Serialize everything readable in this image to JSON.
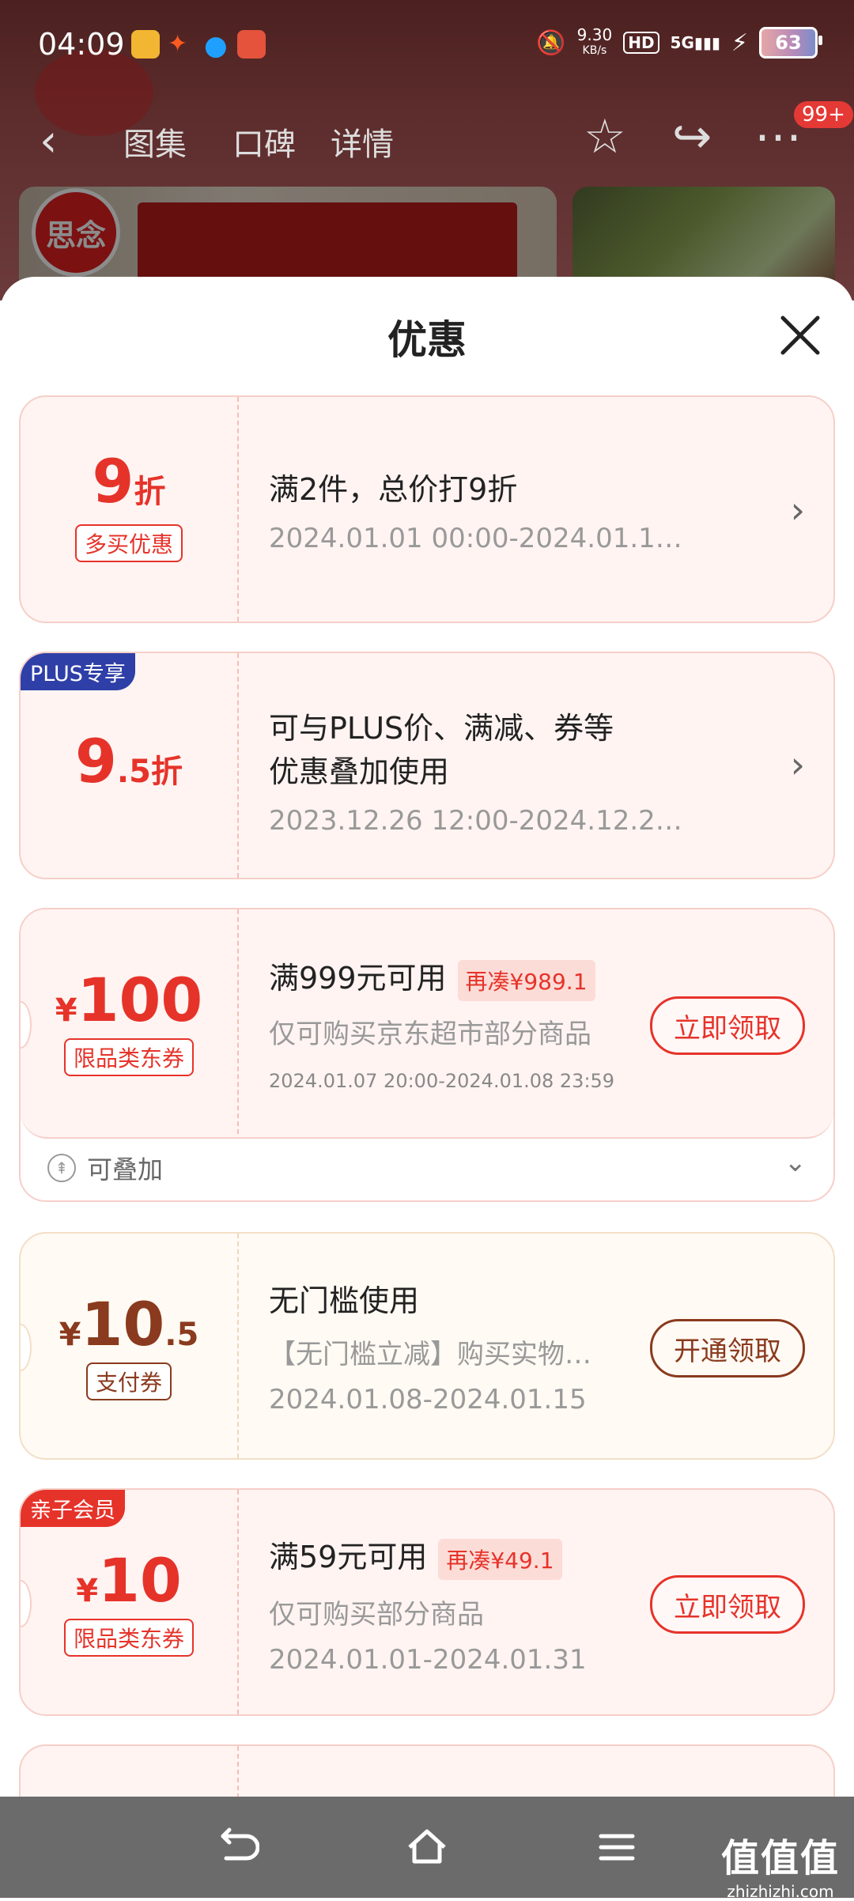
{
  "status_bar": {
    "time": "04:09",
    "network_speed": "9.30",
    "network_unit": "KB/s",
    "hd": "HD",
    "signal": "5G",
    "battery": "63",
    "app_icons": [
      "emoji-app-icon",
      "hot-app-icon",
      "qq-icon",
      "calendar-app-icon"
    ]
  },
  "header": {
    "tabs": [
      "图集",
      "口碑",
      "详情"
    ],
    "badge": "99+",
    "brand_logo_text": "思念"
  },
  "sheet": {
    "title": "优惠",
    "offers": [
      {
        "value": "9",
        "unit": "折",
        "tag": "多买优惠",
        "line1": "满2件，总价打9折",
        "line2": "2024.01.01 00:00-2024.01.1…"
      },
      {
        "corner": "PLUS专享",
        "value": "9",
        "value_suffix": ".5",
        "unit": "折",
        "line1": "可与PLUS价、满减、券等",
        "line1b": "优惠叠加使用",
        "line2": "2023.12.26 12:00-2024.12.2…"
      },
      {
        "currency": "¥",
        "value": "100",
        "tag": "限品类东券",
        "line1": "满999元可用",
        "hint": "再凑¥989.1",
        "line2": "仅可购买京东超市部分商品",
        "line3": "2024.01.07 20:00-2024.01.08 23:59",
        "button": "立即领取",
        "footer": "可叠加"
      },
      {
        "currency": "¥",
        "value": "10",
        "value_suffix": ".5",
        "tag": "支付券",
        "line1": "无门槛使用",
        "line2": "【无门槛立减】购买实物…",
        "line3": "2024.01.08-2024.01.15",
        "button": "开通领取"
      },
      {
        "corner": "亲子会员",
        "currency": "¥",
        "value": "10",
        "tag": "限品类东券",
        "line1": "满59元可用",
        "hint": "再凑¥49.1",
        "line2": "仅可购买部分商品",
        "line3": "2024.01.01-2024.01.31",
        "button": "立即领取"
      }
    ]
  },
  "watermark": {
    "brand": "值值值",
    "url": "zhizhizhi.com"
  },
  "colors": {
    "accent_red": "#e6332a",
    "plus_blue": "#2f3fa8",
    "card_bg": "#fff4f2",
    "pay_brown": "#8a3a1e"
  }
}
